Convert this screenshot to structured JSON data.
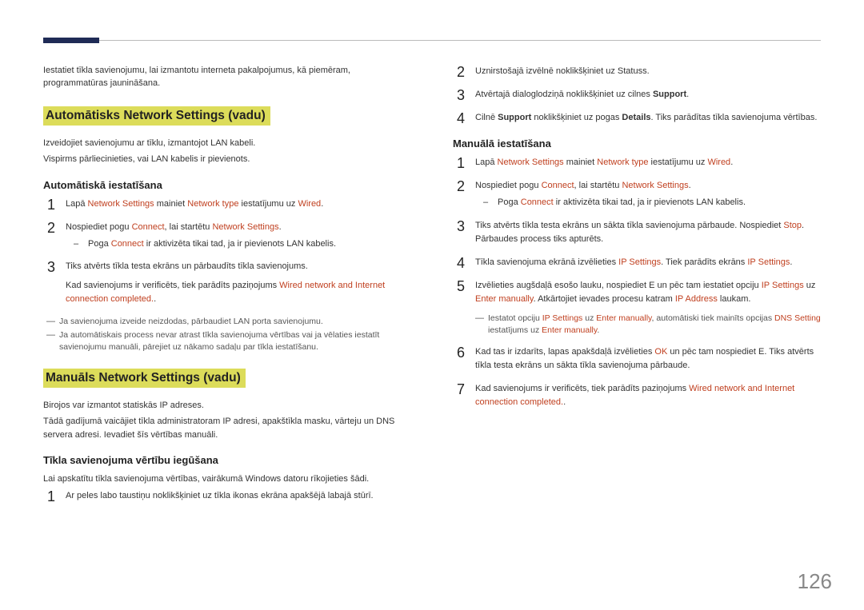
{
  "pageNumber": "126",
  "left": {
    "intro": "Iestatiet tīkla savienojumu, lai izmantotu interneta pakalpojumus, kā piemēram, programmatūras jaunināšana.",
    "section1Title": "Automātisks Network Settings (vadu)",
    "s1p1": "Izveidojiet savienojumu ar tīklu, izmantojot LAN kabeli.",
    "s1p2": "Vispirms pārliecinieties, vai LAN kabelis ir pievienots.",
    "sub1": "Automātiskā iestatīšana",
    "auto": {
      "s1a": "Lapā ",
      "s1b": "Network Settings",
      "s1c": " mainiet ",
      "s1d": "Network type",
      "s1e": " iestatījumu uz ",
      "s1f": "Wired",
      "s1g": ".",
      "s2a": "Nospiediet pogu ",
      "s2b": "Connect",
      "s2c": ", lai startētu ",
      "s2d": "Network Settings",
      "s2e": ".",
      "n1a": "Poga ",
      "n1b": "Connect",
      "n1c": " ir aktivizēta tikai tad, ja ir pievienots LAN kabelis.",
      "s3": "Tiks atvērts tīkla testa ekrāns un pārbaudīts tīkla savienojums.",
      "s3b1": "Kad savienojums ir verificēts, tiek parādīts paziņojums ",
      "s3b2": "Wired network and Internet connection completed.",
      "s3b3": "."
    },
    "fn1": "Ja savienojuma izveide neizdodas, pārbaudiet LAN porta savienojumu.",
    "fn2": "Ja automātiskais process nevar atrast tīkla savienojuma vērtības vai ja vēlaties iestatīt savienojumu manuāli, pārejiet uz nākamo sadaļu par tīkla iestatīšanu.",
    "section2Title": "Manuāls Network Settings (vadu)",
    "s2p1": "Birojos var izmantot statiskās IP adreses.",
    "s2p2": "Tādā gadījumā vaicājiet tīkla administratoram IP adresi, apakštīkla masku, vārteju un DNS servera adresi. Ievadiet šīs vērtības manuāli.",
    "sub2": "Tīkla savienojuma vērtību iegūšana",
    "sub2p": "Lai apskatītu tīkla savienojuma vērtības, vairākumā Windows datoru rīkojieties šādi.",
    "l1": "Ar peles labo taustiņu noklikšķiniet uz tīkla ikonas ekrāna apakšējā labajā stūrī."
  },
  "right": {
    "top": {
      "s2": "Uznirstošajā izvēlnē noklikšķiniet uz Statuss.",
      "s3a": "Atvērtajā dialoglodziņā noklikšķiniet uz cilnes ",
      "s3b": "Support",
      "s3c": ".",
      "s4a": "Cilnē ",
      "s4b": "Support",
      "s4c": " noklikšķiniet uz pogas ",
      "s4d": "Details",
      "s4e": ". Tiks parādītas tīkla savienojuma vērtības."
    },
    "sub": "Manuālā iestatīšana",
    "man": {
      "s1a": "Lapā ",
      "s1b": "Network Settings",
      "s1c": " mainiet ",
      "s1d": "Network type",
      "s1e": " iestatījumu uz ",
      "s1f": "Wired",
      "s1g": ".",
      "s2a": "Nospiediet pogu ",
      "s2b": "Connect",
      "s2c": ", lai startētu ",
      "s2d": "Network Settings",
      "s2e": ".",
      "n1a": "Poga ",
      "n1b": "Connect",
      "n1c": " ir aktivizēta tikai tad, ja ir pievienots LAN kabelis.",
      "s3a": "Tiks atvērts tīkla testa ekrāns un sākta tīkla savienojuma pārbaude. Nospiediet ",
      "s3b": "Stop",
      "s3c": ". Pārbaudes process tiks apturēts.",
      "s4a": "Tīkla savienojuma ekrānā izvēlieties ",
      "s4b": "IP Settings",
      "s4c": ". Tiek parādīts ekrāns ",
      "s4d": "IP Settings",
      "s4e": ".",
      "s5a": "Izvēlieties augšdaļā esošo lauku, nospiediet ",
      "s5b": "E",
      "s5c": " un pēc tam iestatiet opciju   ",
      "s5d": "IP Settings",
      "s5e": " uz ",
      "s5f": "Enter manually",
      "s5g": ". Atkārtojiet ievades procesu katram ",
      "s5h": "IP Address",
      "s5i": " laukam.",
      "fn_a": "Iestatot opciju ",
      "fn_b": "IP Settings",
      "fn_c": " uz ",
      "fn_d": "Enter manually",
      "fn_e": ", automātiski tiek mainīts opcijas ",
      "fn_f": "DNS Setting",
      "fn_g": " iestatījums uz ",
      "fn_h": "Enter manually",
      "fn_i": ".",
      "s6a": "Kad tas ir izdarīts, lapas apakšdaļā izvēlieties ",
      "s6b": "OK",
      "s6c": " un pēc tam nospiediet ",
      "s6d": "E",
      "s6e": ". Tiks atvērts tīkla testa ekrāns un sākta tīkla savienojuma pārbaude.",
      "s7a": "Kad savienojums ir verificēts, tiek parādīts paziņojums ",
      "s7b": "Wired network and Internet connection completed.",
      "s7c": "."
    }
  }
}
